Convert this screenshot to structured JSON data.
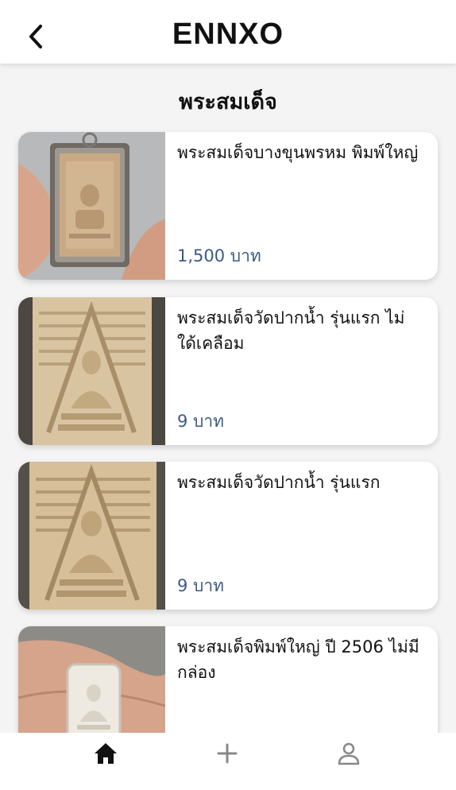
{
  "header": {
    "title": "ENNXO",
    "back_icon": "chevron-left-icon"
  },
  "section": {
    "title": "พระสมเด็จ"
  },
  "listings": [
    {
      "title": "พระสมเด็จบางขุนพรหม พิมพ์ใหญ่",
      "price": "1,500 บาท"
    },
    {
      "title": "พระสมเด็จวัดปากน้ำ รุ่นแรก ไม่ใด้เคลือม",
      "price": "9 บาท"
    },
    {
      "title": "พระสมเด็จวัดปากน้ำ รุ่นแรก",
      "price": "9 บาท"
    },
    {
      "title": "พระสมเด็จพิมพ์ใหญ่ ปี 2506 ไม่มีกล่อง",
      "price": ""
    }
  ],
  "bottom_nav": {
    "items": [
      {
        "icon": "home-icon",
        "active": true
      },
      {
        "icon": "plus-icon",
        "active": false
      },
      {
        "icon": "profile-icon",
        "active": false
      }
    ]
  },
  "colors": {
    "price": "#3d5a86",
    "background": "#f4f4f4",
    "active_icon": "#111111",
    "inactive_icon": "#888888"
  }
}
